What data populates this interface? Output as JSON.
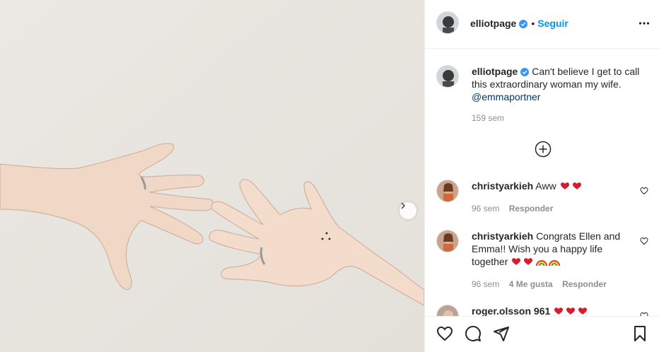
{
  "post": {
    "image_alt": "Two hands reaching toward each other wearing rings",
    "next_icon": "chevron-right-icon"
  },
  "header": {
    "username": "elliotpage",
    "verified_icon": "verified-badge-icon",
    "separator": "•",
    "follow_label": "Seguir",
    "more_icon": "more-horizontal-icon"
  },
  "caption": {
    "username": "elliotpage",
    "text": "Can't believe I get to call this extraordinary woman my wife.",
    "mention": "@emmaportner",
    "time": "159 sem"
  },
  "load_more_icon": "plus-circle-icon",
  "comments": [
    {
      "username": "christyarkieh",
      "text": "Aww",
      "emojis": [
        "heart-eyes",
        "heart-eyes"
      ],
      "time": "96 sem",
      "likes": "",
      "reply_label": "Responder"
    },
    {
      "username": "christyarkieh",
      "text": "Congrats Ellen and Emma!! Wish you a happy life together",
      "emojis": [
        "heart-eyes",
        "heart-eyes",
        "rainbow",
        "rainbow"
      ],
      "time": "96 sem",
      "likes": "4 Me gusta",
      "reply_label": "Responder"
    },
    {
      "username": "roger.olsson 961",
      "text": "",
      "emojis": [
        "heart",
        "heart",
        "heart"
      ],
      "time": "",
      "likes": "",
      "reply_label": ""
    }
  ],
  "actions": {
    "like_icon": "heart-outline-icon",
    "comment_icon": "comment-icon",
    "share_icon": "paper-plane-icon",
    "save_icon": "bookmark-icon"
  },
  "colors": {
    "accent": "#0095f6",
    "verified": "#3897f0",
    "muted": "#8e8e8e",
    "text": "#262626",
    "photo_bg": "#e9e6e1"
  }
}
